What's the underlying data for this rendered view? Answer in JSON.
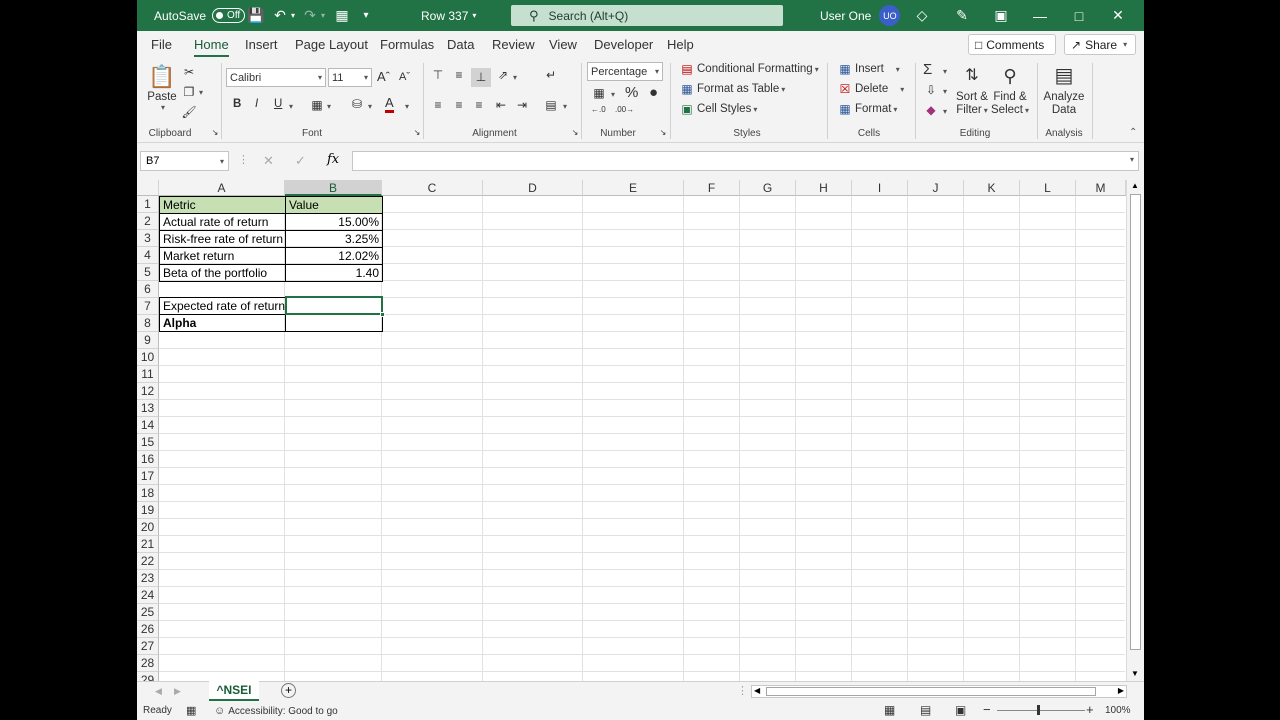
{
  "titlebar": {
    "autosave_label": "AutoSave",
    "autosave_state": "Off",
    "doc_title": "Row 337",
    "search_placeholder": "Search (Alt+Q)",
    "user_name": "User One",
    "user_initials": "UO"
  },
  "tabs": [
    "File",
    "Home",
    "Insert",
    "Page Layout",
    "Formulas",
    "Data",
    "Review",
    "View",
    "Developer",
    "Help"
  ],
  "active_tab": "Home",
  "top_buttons": {
    "comments": "Comments",
    "share": "Share"
  },
  "ribbon": {
    "clipboard": {
      "paste": "Paste",
      "label": "Clipboard"
    },
    "font": {
      "name": "Calibri",
      "size": "11",
      "label": "Font"
    },
    "alignment": {
      "label": "Alignment"
    },
    "number": {
      "format": "Percentage",
      "label": "Number"
    },
    "styles": {
      "conditional": "Conditional Formatting",
      "table": "Format as Table",
      "cell_styles": "Cell Styles",
      "label": "Styles"
    },
    "cells": {
      "insert": "Insert",
      "delete": "Delete",
      "format": "Format",
      "label": "Cells"
    },
    "editing": {
      "sort1": "Sort &",
      "sort2": "Filter",
      "find1": "Find &",
      "find2": "Select",
      "label": "Editing"
    },
    "analysis": {
      "analyze1": "Analyze",
      "analyze2": "Data",
      "label": "Analysis"
    }
  },
  "formula_bar": {
    "name_box": "B7",
    "fx": "fx",
    "value": ""
  },
  "columns": [
    "A",
    "B",
    "C",
    "D",
    "E",
    "F",
    "G",
    "H",
    "I",
    "J",
    "K",
    "L",
    "M"
  ],
  "rows": [
    "1",
    "2",
    "3",
    "4",
    "5",
    "6",
    "7",
    "8",
    "9",
    "10",
    "11",
    "12",
    "13",
    "14",
    "15",
    "16",
    "17",
    "18",
    "19",
    "20",
    "21",
    "22",
    "23",
    "24",
    "25",
    "26",
    "27",
    "28",
    "29"
  ],
  "cells": {
    "a1": "Metric",
    "b1": "Value",
    "a2": "Actual rate of return",
    "b2": "15.00%",
    "a3": "Risk-free rate of return",
    "b3": "3.25%",
    "a4": "Market return",
    "b4": "12.02%",
    "a5": "Beta of the portfolio",
    "b5": "1.40",
    "a7": "Expected rate of return",
    "b7": "",
    "a8": "Alpha",
    "b8": ""
  },
  "sheet_tab": "^NSEI",
  "status": {
    "ready": "Ready",
    "accessibility": "Accessibility: Good to go",
    "zoom": "100%"
  },
  "colors": {
    "accent": "#217346",
    "header_fill": "#c6e0b4"
  }
}
